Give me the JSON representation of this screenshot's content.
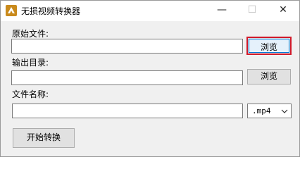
{
  "window": {
    "title": "无损视频转换器",
    "icon": "app-logo-icon",
    "controls": {
      "minimize": "—",
      "maximize": "☐",
      "close": "✕"
    }
  },
  "source": {
    "label": "原始文件:",
    "value": "",
    "browse_label": "浏览"
  },
  "output_dir": {
    "label": "输出目录:",
    "value": "",
    "browse_label": "浏览"
  },
  "file_name": {
    "label": "文件名称:",
    "value": "",
    "ext_selected": ".mp4"
  },
  "start_label": "开始转换",
  "colors": {
    "focus_border": "#d11a2a",
    "accent": "#0078d7",
    "logo": "#c98a1c"
  }
}
